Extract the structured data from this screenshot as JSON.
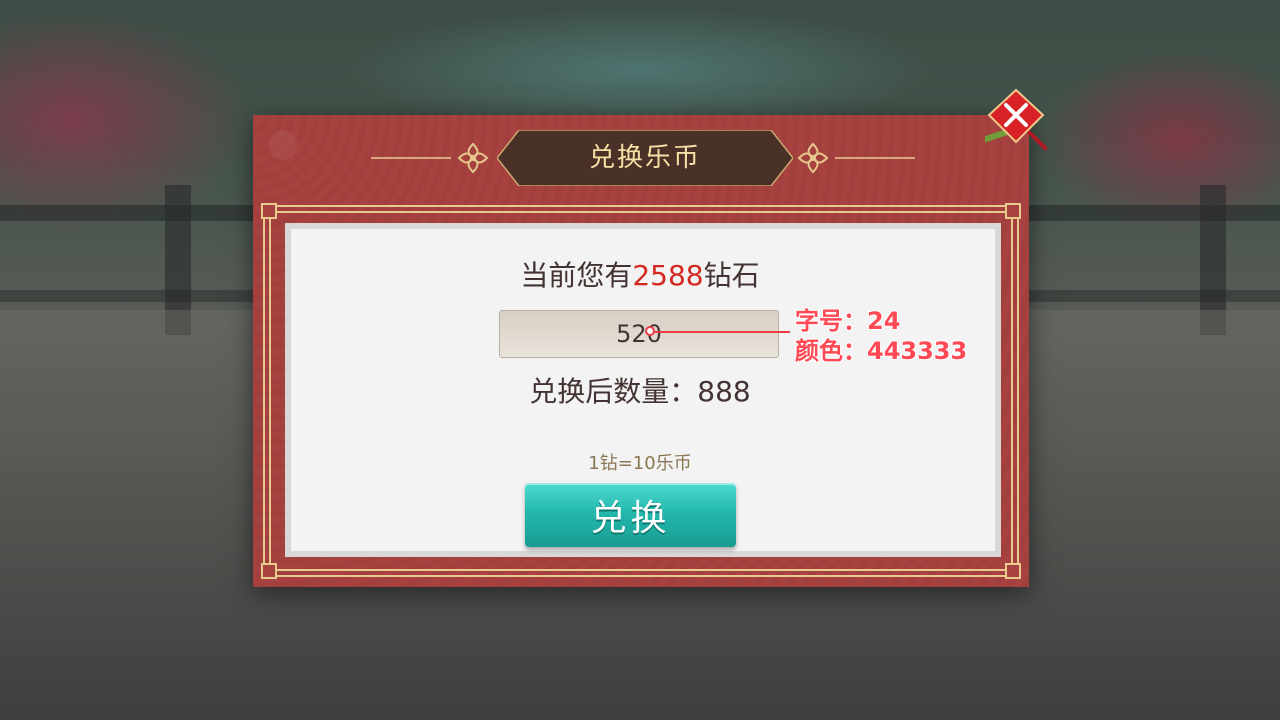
{
  "dialog": {
    "title": "兑换乐币",
    "close_icon": "close-x-icon"
  },
  "balance": {
    "prefix": "当前您有",
    "amount": "2588",
    "suffix": "钻石"
  },
  "input": {
    "value": "520"
  },
  "result": {
    "label": "兑换后数量：",
    "value": "888"
  },
  "rate": {
    "text": "1钻=10乐币"
  },
  "actions": {
    "exchange_label": "兑换"
  },
  "annotation": {
    "font_size": "字号：24",
    "color": "颜色：443333"
  },
  "colors": {
    "text": "#443333",
    "highlight": "#d3281f",
    "frame": "#a84240",
    "button": "#25b8ad",
    "annotation": "#ee3a42"
  }
}
